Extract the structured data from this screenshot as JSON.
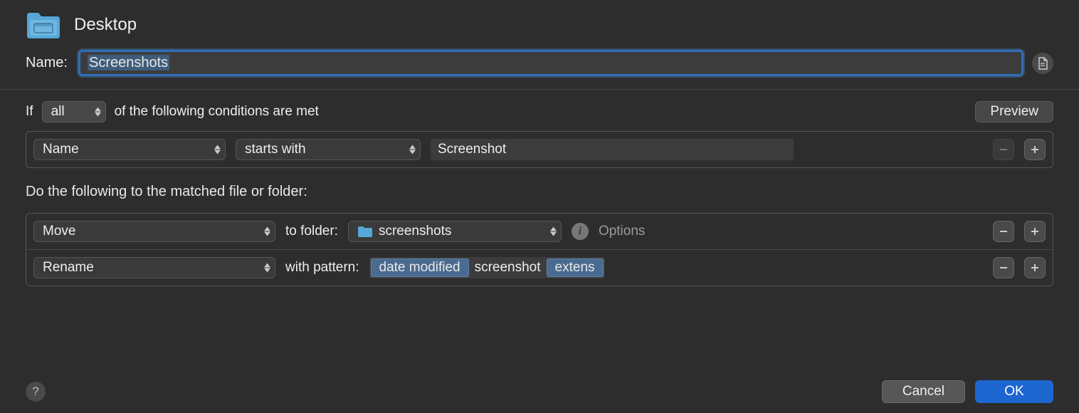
{
  "header": {
    "folder_title": "Desktop"
  },
  "name": {
    "label": "Name:",
    "value": "Screenshots"
  },
  "conditions": {
    "if_text": "If",
    "scope": "all",
    "of_text": "of the following conditions are met",
    "preview": "Preview",
    "rows": [
      {
        "field": "Name",
        "operator": "starts with",
        "value": "Screenshot"
      }
    ]
  },
  "actions": {
    "heading": "Do the following to the matched file or folder:",
    "rows": [
      {
        "action": "Move",
        "to_label": "to folder:",
        "folder": "screenshots",
        "options_label": "Options"
      },
      {
        "action": "Rename",
        "with_label": "with pattern:",
        "tokens": [
          {
            "type": "token",
            "text": "date modified"
          },
          {
            "type": "plain",
            "text": "screenshot"
          },
          {
            "type": "token",
            "text": "extens"
          }
        ]
      }
    ]
  },
  "footer": {
    "cancel": "Cancel",
    "ok": "OK"
  }
}
